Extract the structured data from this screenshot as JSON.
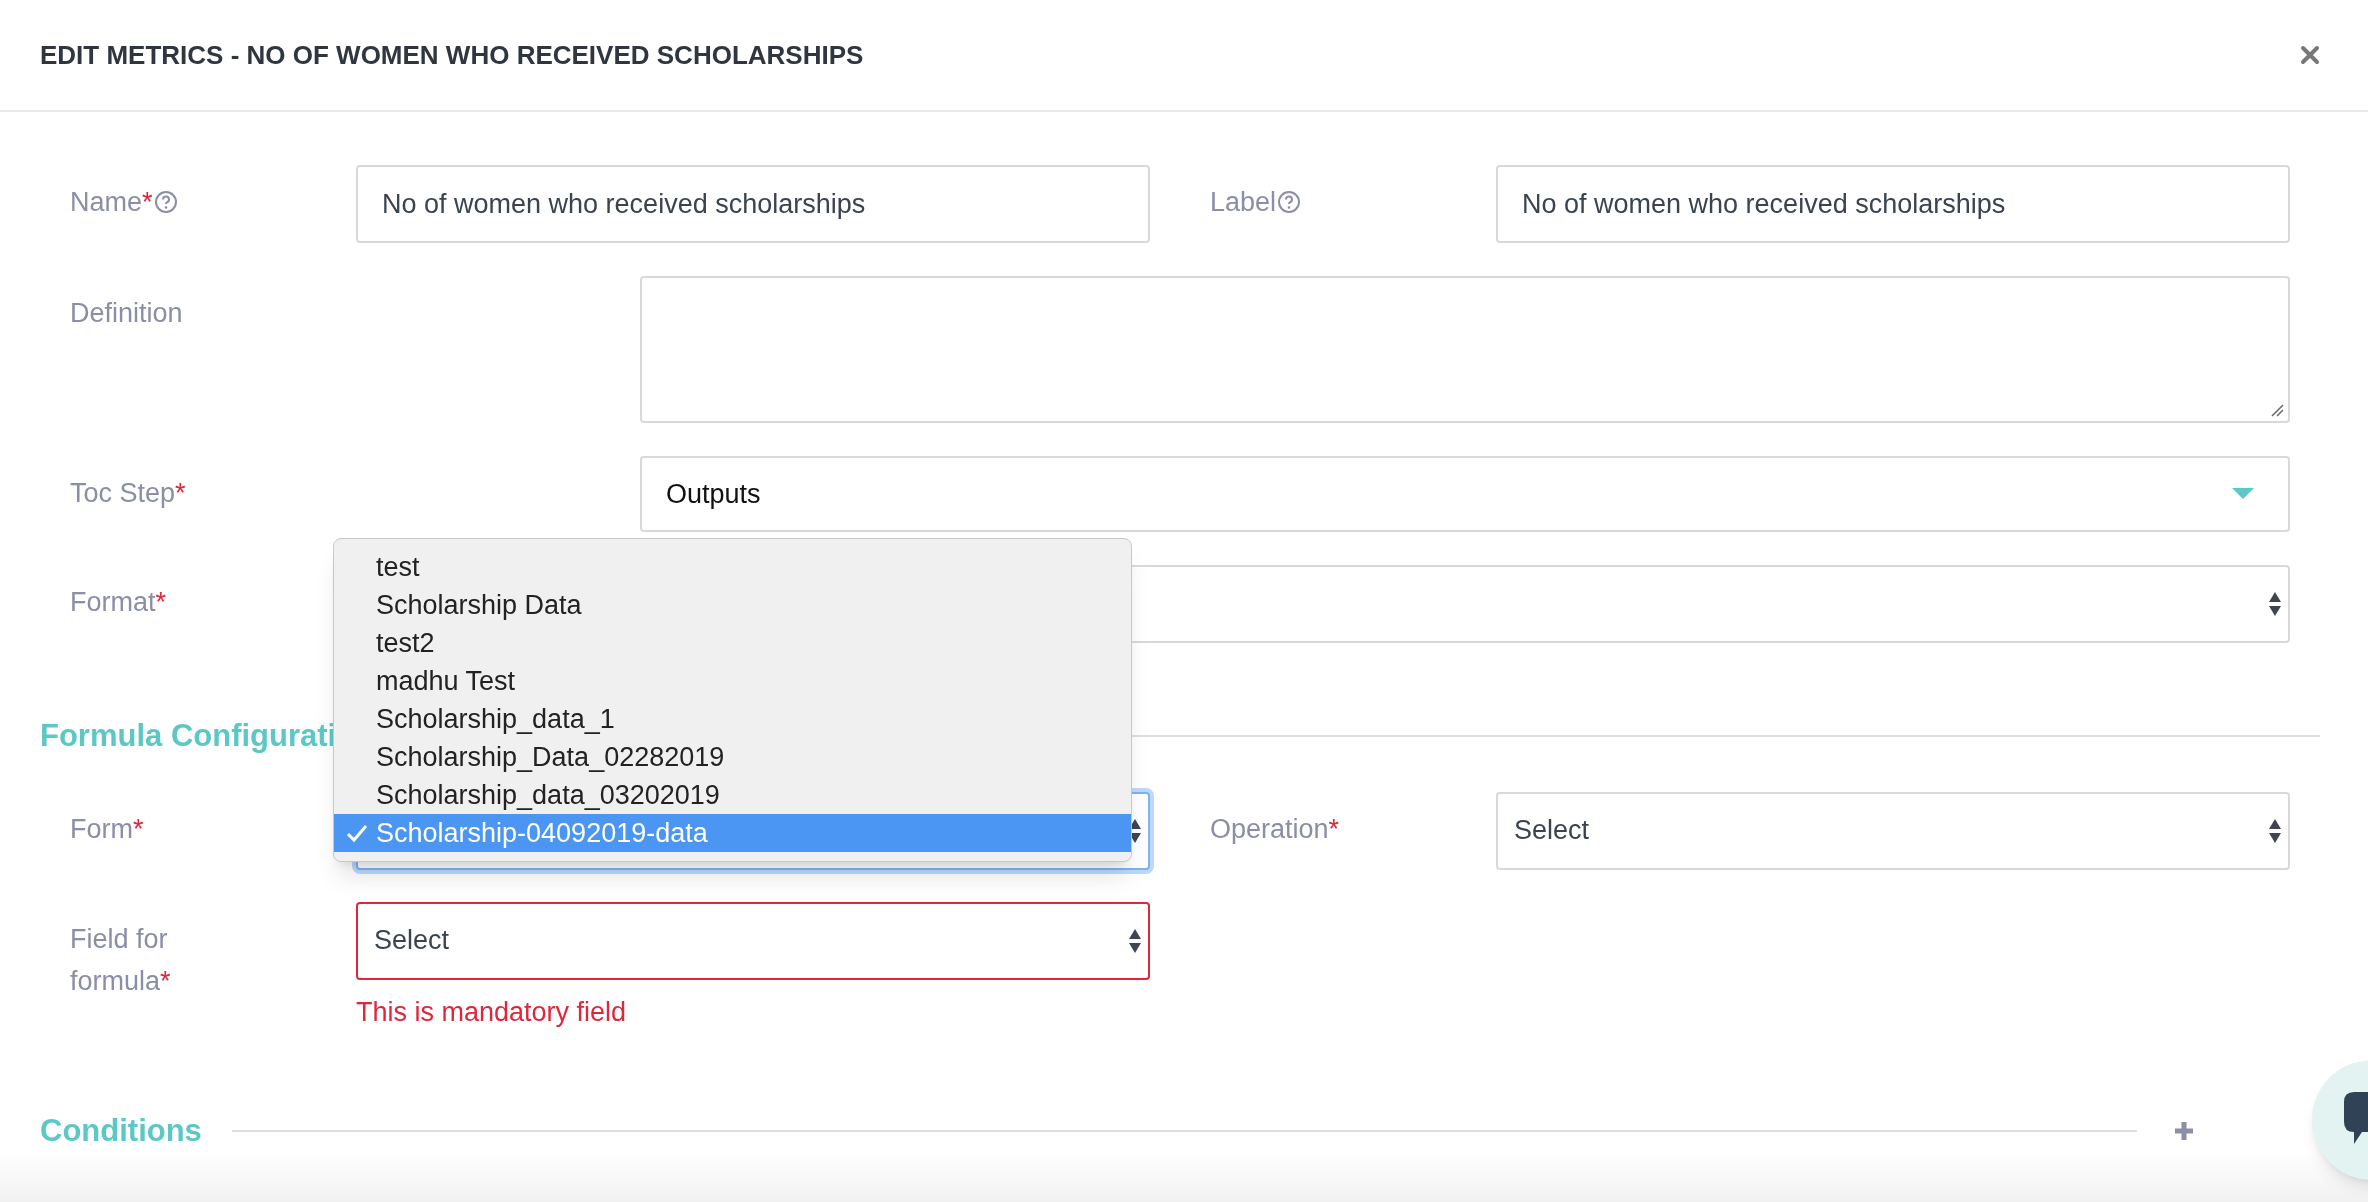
{
  "dialog": {
    "title": "EDIT METRICS - NO OF WOMEN WHO RECEIVED SCHOLARSHIPS"
  },
  "top_rows": [
    {
      "kind": "split",
      "fields": [
        {
          "label": "Name",
          "required_mark": "*",
          "help": true,
          "kind": "text",
          "value": "No of women who received scholarships"
        },
        {
          "label": "Label",
          "help": true,
          "kind": "text",
          "value": "No of women who received scholarships"
        }
      ]
    },
    {
      "kind": "wide",
      "fields": [
        {
          "label": "Definition",
          "kind": "textarea"
        }
      ]
    },
    {
      "kind": "wide",
      "fields": [
        {
          "label": "Toc Step",
          "required_mark": "*",
          "kind": "dropdown",
          "value": "Outputs"
        }
      ]
    },
    {
      "kind": "wide",
      "fields": [
        {
          "label": "Format",
          "required_mark": "*",
          "kind": "select"
        }
      ]
    }
  ],
  "formula_section": {
    "heading": "Formula Configurati",
    "rows": [
      {
        "fields": [
          {
            "label": "Form",
            "required_mark": "*",
            "kind": "select",
            "focused": true
          },
          {
            "label": "Operation",
            "required_mark": "*",
            "kind": "select",
            "value": "Select",
            "focused": false
          }
        ]
      },
      {
        "fields": [
          {
            "label": "Field for formula",
            "required_mark": "*",
            "kind": "select",
            "value": "Select",
            "error": "This is mandatory field"
          }
        ]
      }
    ]
  },
  "open_menu": {
    "options": [
      {
        "label": "test",
        "selected": false
      },
      {
        "label": "Scholarship Data",
        "selected": false
      },
      {
        "label": "test2",
        "selected": false
      },
      {
        "label": "madhu Test",
        "selected": false
      },
      {
        "label": "Scholarship_data_1",
        "selected": false
      },
      {
        "label": "Scholarship_Data_02282019",
        "selected": false
      },
      {
        "label": "Scholarship_data_03202019",
        "selected": false
      },
      {
        "label": "Scholarship-04092019-data",
        "selected": true
      }
    ]
  },
  "conditions": {
    "heading": "Conditions"
  }
}
